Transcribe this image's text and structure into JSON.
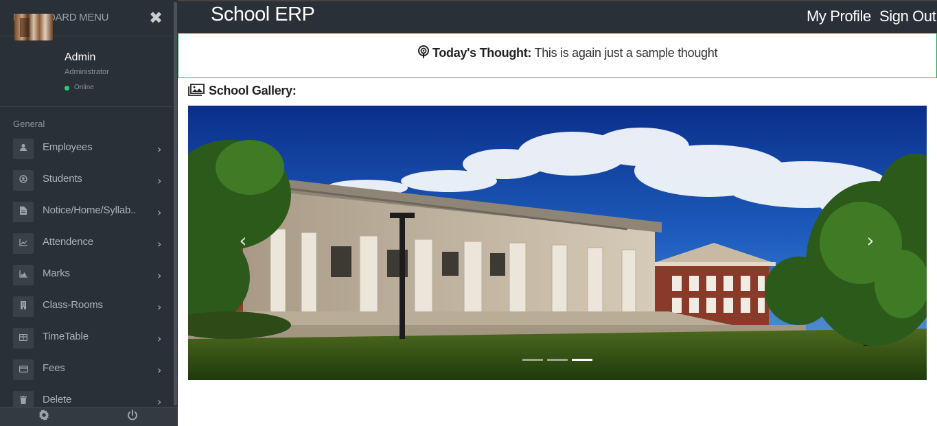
{
  "sidebar": {
    "title": "DASHBOARD MENU",
    "close_icon": "close-icon",
    "profile": {
      "name": "Admin",
      "role": "Administrator",
      "status": "Online",
      "status_color": "#2ecc71"
    },
    "section_label": "General",
    "items": [
      {
        "label": "Employees",
        "icon": "user-icon"
      },
      {
        "label": "Students",
        "icon": "student-icon"
      },
      {
        "label": "Notice/Home/Syllab..",
        "icon": "document-icon"
      },
      {
        "label": "Attendence",
        "icon": "area-chart-icon"
      },
      {
        "label": "Marks",
        "icon": "bar-chart-icon"
      },
      {
        "label": "Class-Rooms",
        "icon": "building-icon"
      },
      {
        "label": "TimeTable",
        "icon": "table-icon"
      },
      {
        "label": "Fees",
        "icon": "credit-card-icon"
      },
      {
        "label": "Delete",
        "icon": "trash-icon"
      }
    ],
    "footer": {
      "settings_icon": "gear-icon",
      "power_icon": "power-icon"
    }
  },
  "header": {
    "brand": "School ERP",
    "my_profile": "My Profile",
    "sign_out": "Sign Out",
    "bg_color": "#2a3038"
  },
  "thought": {
    "label": "Today's Thought:",
    "text": " This is again just a sample thought",
    "border_color": "#2e9e5b"
  },
  "gallery": {
    "title": "School Gallery:",
    "slide_count": 3,
    "active_slide": 3
  }
}
